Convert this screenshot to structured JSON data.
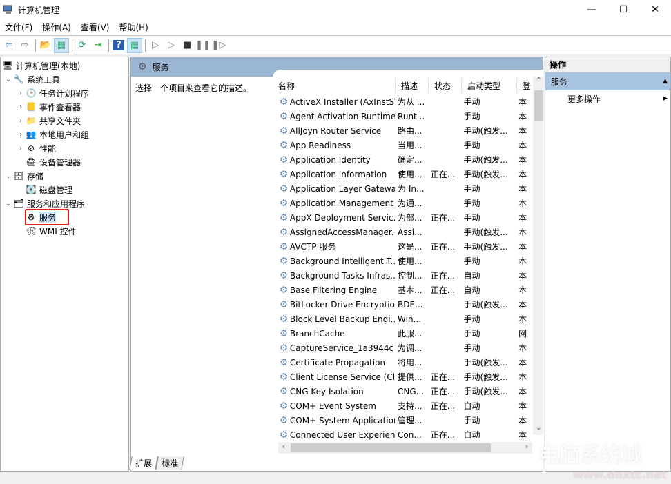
{
  "window": {
    "title": "计算机管理",
    "minimize": "—",
    "maximize": "☐",
    "close": "✕"
  },
  "menu": [
    "文件(F)",
    "操作(A)",
    "查看(V)",
    "帮助(H)"
  ],
  "toolbar": [
    {
      "name": "back-icon",
      "glyph": "⇦",
      "color": "#2b7cd3"
    },
    {
      "name": "forward-icon",
      "glyph": "⇨",
      "color": "#777"
    },
    {
      "name": "up-folder-icon",
      "glyph": "📂",
      "color": "#d9a520"
    },
    {
      "name": "show-hide-tree-icon",
      "glyph": "▦",
      "color": "#3a7"
    },
    {
      "name": "refresh-icon",
      "glyph": "⟳",
      "color": "#2a8"
    },
    {
      "name": "export-list-icon",
      "glyph": "⇥",
      "color": "#3a3"
    },
    {
      "name": "help-icon",
      "glyph": "?",
      "color": "#fff"
    },
    {
      "name": "show-action-pane-icon",
      "glyph": "▦",
      "color": "#3a7"
    },
    {
      "name": "start-service-icon",
      "glyph": "▷",
      "color": "#777"
    },
    {
      "name": "start-icon",
      "glyph": "▷",
      "color": "#777"
    },
    {
      "name": "stop-service-icon",
      "glyph": "■",
      "color": "#333"
    },
    {
      "name": "pause-service-icon",
      "glyph": "❚❚",
      "color": "#777"
    },
    {
      "name": "resume-service-icon",
      "glyph": "❚▷",
      "color": "#777"
    }
  ],
  "tree": [
    {
      "label": "计算机管理(本地)",
      "icon": "computer-icon",
      "glyph": "🖥",
      "level": 0,
      "expander": ""
    },
    {
      "label": "系统工具",
      "icon": "tools-icon",
      "glyph": "🔧",
      "level": 1,
      "expander": "⌄"
    },
    {
      "label": "任务计划程序",
      "icon": "clock-icon",
      "glyph": "🕒",
      "level": 2,
      "expander": "›"
    },
    {
      "label": "事件查看器",
      "icon": "event-viewer-icon",
      "glyph": "📒",
      "level": 2,
      "expander": "›"
    },
    {
      "label": "共享文件夹",
      "icon": "shared-folder-icon",
      "glyph": "📁",
      "level": 2,
      "expander": "›"
    },
    {
      "label": "本地用户和组",
      "icon": "users-icon",
      "glyph": "👥",
      "level": 2,
      "expander": "›"
    },
    {
      "label": "性能",
      "icon": "performance-icon",
      "glyph": "⊘",
      "level": 2,
      "expander": "›"
    },
    {
      "label": "设备管理器",
      "icon": "device-manager-icon",
      "glyph": "🖨",
      "level": 2,
      "expander": ""
    },
    {
      "label": "存储",
      "icon": "storage-icon",
      "glyph": "🗄",
      "level": 1,
      "expander": "⌄"
    },
    {
      "label": "磁盘管理",
      "icon": "disk-icon",
      "glyph": "💽",
      "level": 2,
      "expander": ""
    },
    {
      "label": "服务和应用程序",
      "icon": "services-apps-icon",
      "glyph": "🗂",
      "level": 1,
      "expander": "⌄"
    },
    {
      "label": "服务",
      "icon": "services-gear-icon",
      "glyph": "⚙",
      "level": 2,
      "expander": "",
      "selected": true
    },
    {
      "label": "WMI 控件",
      "icon": "wmi-icon",
      "glyph": "🛠",
      "level": 2,
      "expander": ""
    }
  ],
  "center": {
    "header": "服务",
    "description": "选择一个项目来查看它的描述。",
    "columns": [
      "名称",
      "描述",
      "状态",
      "启动类型",
      "登"
    ],
    "sort_indicator": "^",
    "services": [
      [
        "ActiveX Installer (AxInstSV)",
        "为从 ...",
        "",
        "手动",
        "本"
      ],
      [
        "Agent Activation Runtime...",
        "Runt...",
        "",
        "手动",
        "本"
      ],
      [
        "AllJoyn Router Service",
        "路由...",
        "",
        "手动(触发...",
        "本"
      ],
      [
        "App Readiness",
        "当用...",
        "",
        "手动",
        "本"
      ],
      [
        "Application Identity",
        "确定...",
        "",
        "手动(触发...",
        "本"
      ],
      [
        "Application Information",
        "使用...",
        "正在...",
        "手动(触发...",
        "本"
      ],
      [
        "Application Layer Gatewa...",
        "为 In...",
        "",
        "手动",
        "本"
      ],
      [
        "Application Management",
        "为通...",
        "",
        "手动",
        "本"
      ],
      [
        "AppX Deployment Servic...",
        "为部...",
        "正在...",
        "手动",
        "本"
      ],
      [
        "AssignedAccessManager...",
        "Assi...",
        "",
        "手动(触发...",
        "本"
      ],
      [
        "AVCTP 服务",
        "这是...",
        "正在...",
        "手动(触发...",
        "本"
      ],
      [
        "Background Intelligent T...",
        "使用...",
        "",
        "手动",
        "本"
      ],
      [
        "Background Tasks Infras...",
        "控制...",
        "正在...",
        "自动",
        "本"
      ],
      [
        "Base Filtering Engine",
        "基本...",
        "正在...",
        "自动",
        "本"
      ],
      [
        "BitLocker Drive Encryptio...",
        "BDE...",
        "",
        "手动(触发...",
        "本"
      ],
      [
        "Block Level Backup Engi...",
        "Win...",
        "",
        "手动",
        "本"
      ],
      [
        "BranchCache",
        "此服...",
        "",
        "手动",
        "网"
      ],
      [
        "CaptureService_1a3944c",
        "为调...",
        "",
        "手动",
        "本"
      ],
      [
        "Certificate Propagation",
        "将用...",
        "",
        "手动(触发...",
        "本"
      ],
      [
        "Client License Service (Cli...",
        "提供...",
        "正在...",
        "手动(触发...",
        "本"
      ],
      [
        "CNG Key Isolation",
        "CNG...",
        "正在...",
        "手动(触发...",
        "本"
      ],
      [
        "COM+ Event System",
        "支持...",
        "正在...",
        "自动",
        "本"
      ],
      [
        "COM+ System Application",
        "管理...",
        "",
        "手动",
        "本"
      ],
      [
        "Connected User Experien...",
        "Con...",
        "正在...",
        "自动",
        "本"
      ]
    ],
    "tabs": [
      "扩展",
      "标准"
    ]
  },
  "actions": {
    "header": "操作",
    "section": "服务",
    "section_arrow": "▲",
    "items": [
      {
        "label": "更多操作",
        "arrow": "▶"
      }
    ]
  },
  "watermark": {
    "text": "电脑系统城",
    "url": "www.dnxtc.net"
  }
}
